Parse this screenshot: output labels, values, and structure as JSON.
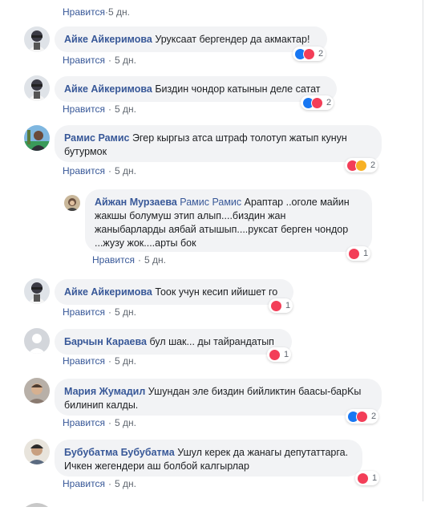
{
  "like_label": "Нравится",
  "separator": "·",
  "colors": {
    "author": "#385898",
    "bubble": "#f2f3f5",
    "meta": "#606770",
    "like": "#1877f2",
    "love": "#f33e58",
    "sad": "#f7b125"
  },
  "top": {
    "like": "Нравится",
    "time": "5 дн."
  },
  "comments": [
    {
      "author": "Айке Айкеримова",
      "text": "Уруксаат бергендер да акмактар!",
      "time": "5 дн.",
      "reactions": [
        "like-icon",
        "love-icon"
      ],
      "count": "2"
    },
    {
      "author": "Айке Айкеримова",
      "text": "Биздин чондор катынын деле сатат",
      "time": "5 дн.",
      "reactions": [
        "like-icon",
        "love-icon"
      ],
      "count": "2"
    },
    {
      "author": "Рамис Рамис",
      "text_line1": "Эгер кыргыз атса штраф толотуп жатып кунун",
      "text_line2": "бутурмок",
      "time": "5 дн.",
      "reactions": [
        "love-icon",
        "sad-icon"
      ],
      "count": "2"
    },
    {
      "author": "Айжан Мурзаева",
      "mention": "Рамис Рамис",
      "text_line1": "Арaптар ..оголе майин",
      "text_line2": "жакшы болумуш этип алып....биздин жан",
      "text_line3": "жаныбарларды аябай атышып....руксат берген чондор",
      "text_line4": "...жузу жок....арты бок",
      "time": "5 дн.",
      "reactions": [
        "love-icon"
      ],
      "count": "1"
    },
    {
      "author": "Айке Айкеримова",
      "text": "Тоок учун кесип ийишет го",
      "time": "5 дн.",
      "reactions": [
        "love-icon"
      ],
      "count": "1"
    },
    {
      "author": "Барчын Караева",
      "text": "бул шак... ды тайрандатып",
      "time": "5 дн.",
      "reactions": [
        "love-icon"
      ],
      "count": "1"
    },
    {
      "author": "Мария Жумадил",
      "text_line1": "Ушундан эле биздин бийликтин баасы-барKы",
      "text_line2": "билинип калды.",
      "time": "5 дн.",
      "reactions": [
        "like-icon",
        "love-icon"
      ],
      "count": "2"
    },
    {
      "author": "Бубубатма Бубубатма",
      "text_line1": "Ушул керек да жанагы депутаттарга.",
      "text_line2": "Ичкен жегендери аш болбой калгырлар",
      "time": "5 дн.",
      "reactions": [
        "love-icon"
      ],
      "count": "1"
    }
  ]
}
